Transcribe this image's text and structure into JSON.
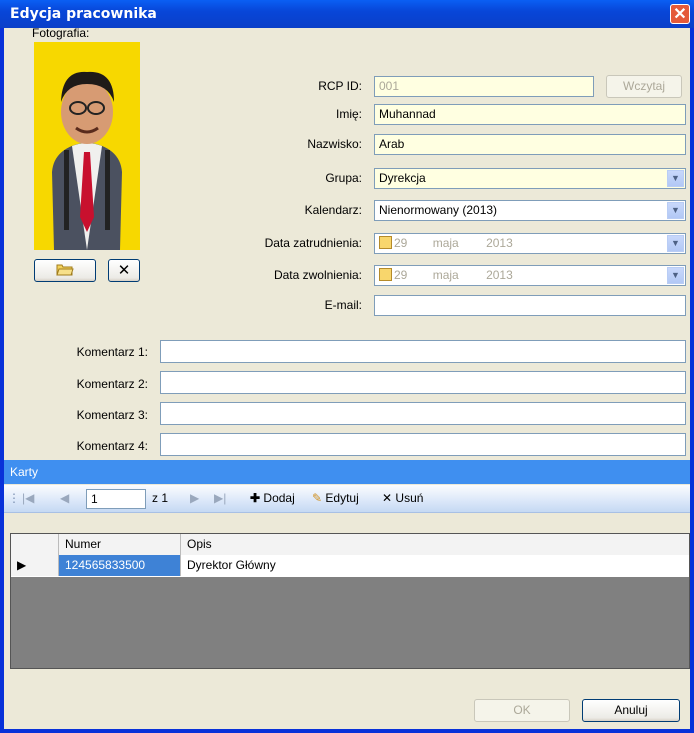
{
  "window": {
    "title": "Edycja pracownika",
    "close": "✕"
  },
  "photo": {
    "label": "Fotografia:"
  },
  "fields": {
    "rcp_label": "RCP ID:",
    "rcp_value": "001",
    "load_button": "Wczytaj",
    "name_label": "Imię:",
    "name_value": "Muhannad",
    "surname_label": "Nazwisko:",
    "surname_value": "Arab",
    "group_label": "Grupa:",
    "group_value": "Dyrekcja",
    "calendar_label": "Kalendarz:",
    "calendar_value": "Nienormowany (2013)",
    "hire_label": "Data zatrudnienia:",
    "hire_day": "29",
    "hire_month": "maja",
    "hire_year": "2013",
    "fire_label": "Data zwolnienia:",
    "fire_day": "29",
    "fire_month": "maja",
    "fire_year": "2013",
    "email_label": "E-mail:",
    "email_value": ""
  },
  "comments": [
    {
      "label": "Komentarz 1:",
      "value": ""
    },
    {
      "label": "Komentarz 2:",
      "value": ""
    },
    {
      "label": "Komentarz 3:",
      "value": ""
    },
    {
      "label": "Komentarz 4:",
      "value": ""
    }
  ],
  "cards": {
    "section_title": "Karty",
    "page_value": "1",
    "page_of": "z 1",
    "add": "Dodaj",
    "edit": "Edytuj",
    "delete": "Usuń",
    "columns": [
      "Numer",
      "Opis"
    ],
    "rows": [
      {
        "numer": "124565833500",
        "opis": "Dyrektor Główny"
      }
    ]
  },
  "footer": {
    "ok": "OK",
    "cancel": "Anuluj"
  },
  "icons": {
    "open": "folder-open-icon",
    "remove": "close-icon",
    "dropdown": "chevron-down-icon",
    "calendar": "calendar-icon"
  }
}
